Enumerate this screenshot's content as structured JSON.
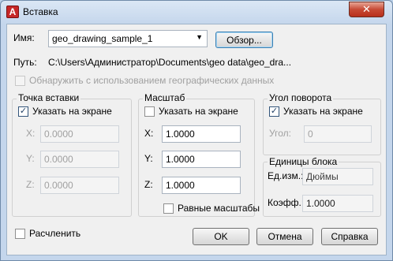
{
  "window": {
    "title": "Вставка",
    "close_glyph": "✕"
  },
  "name": {
    "label": "Имя:",
    "value": "geo_drawing_sample_1",
    "browse_button": "Обзор..."
  },
  "path": {
    "label": "Путь:",
    "value": "C:\\Users\\Администратор\\Documents\\geo data\\geo_dra..."
  },
  "geo_locate": {
    "label": "Обнаружить с использованием географических данных",
    "checked": false
  },
  "insertion_point": {
    "title": "Точка вставки",
    "specify_on_screen": "Указать на экране",
    "x_label": "X:",
    "y_label": "Y:",
    "z_label": "Z:",
    "x": "0.0000",
    "y": "0.0000",
    "z": "0.0000"
  },
  "scale": {
    "title": "Масштаб",
    "specify_on_screen": "Указать на экране",
    "x_label": "X:",
    "y_label": "Y:",
    "z_label": "Z:",
    "x": "1.0000",
    "y": "1.0000",
    "z": "1.0000",
    "uniform": "Равные масштабы"
  },
  "rotation": {
    "title": "Угол поворота",
    "specify_on_screen": "Указать на экране",
    "angle_label": "Угол:",
    "angle": "0"
  },
  "block_unit": {
    "title": "Единицы блока",
    "unit_label": "Ед.изм.:",
    "unit": "Дюймы",
    "factor_label": "Коэфф.:",
    "factor": "1.0000"
  },
  "explode": {
    "label": "Расчленить"
  },
  "buttons": {
    "ok": "OK",
    "cancel": "Отмена",
    "help": "Справка"
  },
  "icons": {
    "app_icon": "autocad-a-icon",
    "check_glyph": "✓",
    "dropdown_glyph": "▼"
  }
}
